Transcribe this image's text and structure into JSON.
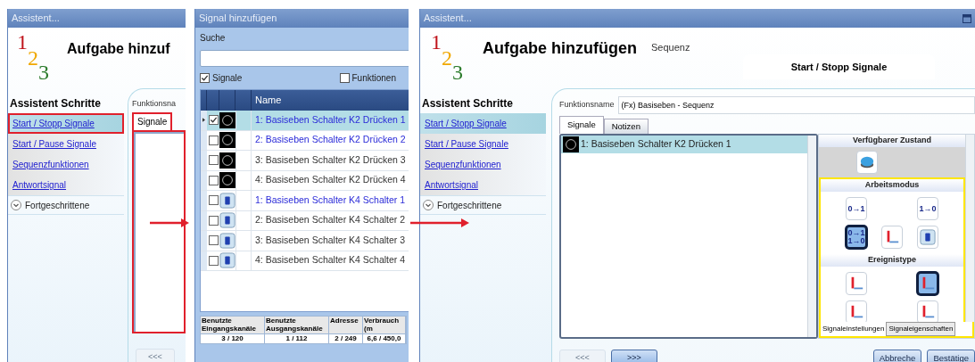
{
  "step1_window": {
    "title": "Assistent...",
    "logo_digits": [
      {
        "text": "1",
        "color": "#c0141c"
      },
      {
        "text": "2",
        "color": "#f0a800"
      },
      {
        "text": "3",
        "color": "#2a7a2a"
      }
    ],
    "heading": "Aufgabe hinzuf",
    "sidebar": {
      "title": "Assistent Schritte",
      "items": [
        {
          "label": "Start / Stopp Signale",
          "selected": true
        },
        {
          "label": "Start / Pause Signale",
          "selected": false
        },
        {
          "label": "Sequenzfunktionen",
          "selected": false
        },
        {
          "label": "Antwortsignal",
          "selected": false
        }
      ],
      "expander": {
        "label": "Fortgeschrittene",
        "expanded": false
      }
    },
    "field_label": "Funktionsna",
    "tabs": [
      {
        "label": "Signale",
        "selected": true
      }
    ],
    "back_button": "<<<"
  },
  "signal_dialog": {
    "title": "Signal hinzufügen",
    "search_label": "Suche",
    "filters": [
      {
        "label": "Signale",
        "checked": true
      },
      {
        "label": "Funktionen",
        "checked": false
      }
    ],
    "column": "Name",
    "rows": [
      {
        "name": "1: Basiseben Schalter K2 Drücken 1",
        "kind": "push",
        "checked": true,
        "selected": true,
        "color": "#2a2ad8"
      },
      {
        "name": "2: Basiseben Schalter K2 Drücken 2",
        "kind": "push",
        "checked": false,
        "selected": false,
        "color": "#2a2ad8"
      },
      {
        "name": "3: Basiseben Schalter K2 Drücken 3",
        "kind": "push",
        "checked": false,
        "selected": false,
        "color": "#333333"
      },
      {
        "name": "4: Basiseben Schalter K2 Drücken 4",
        "kind": "push",
        "checked": false,
        "selected": false,
        "color": "#333333"
      },
      {
        "name": "1: Basiseben Schalter K4 Schalter 1",
        "kind": "switch",
        "checked": false,
        "selected": false,
        "color": "#2a2ad8"
      },
      {
        "name": "2: Basiseben Schalter K4 Schalter 2",
        "kind": "switch",
        "checked": false,
        "selected": false,
        "color": "#333333"
      },
      {
        "name": "3: Basiseben Schalter K4 Schalter 3",
        "kind": "switch",
        "checked": false,
        "selected": false,
        "color": "#333333"
      },
      {
        "name": "4: Basiseben Schalter K4 Schalter 4",
        "kind": "switch",
        "checked": false,
        "selected": false,
        "color": "#333333"
      }
    ],
    "usage": {
      "columns": [
        "Benutzte Eingangskanäle",
        "Benutzte Ausgangskanäle",
        "Adresse",
        "Verbrauch (m"
      ],
      "values": [
        "3 / 120",
        "1 / 112",
        "2 / 249",
        "6,6 / 450,0"
      ]
    }
  },
  "step2_window": {
    "title": "Assistent...",
    "logo_digits": [
      {
        "text": "1",
        "color": "#c0141c"
      },
      {
        "text": "2",
        "color": "#f0a800"
      },
      {
        "text": "3",
        "color": "#2a7a2a"
      }
    ],
    "heading": "Aufgabe hinzufügen",
    "subheading": "Sequenz",
    "step_title": "Start / Stopp Signale",
    "sidebar": {
      "title": "Assistent Schritte",
      "items": [
        {
          "label": "Start / Stopp Signale",
          "selected": true
        },
        {
          "label": "Start / Pause Signale",
          "selected": false
        },
        {
          "label": "Sequenzfunktionen",
          "selected": false
        },
        {
          "label": "Antwortsignal",
          "selected": false
        }
      ],
      "expander": {
        "label": "Fortgeschrittene",
        "expanded": false
      }
    },
    "field_label": "Funktionsname",
    "field_value": "(Fx) Basiseben - Sequenz",
    "tabs": [
      {
        "label": "Signale",
        "selected": true
      },
      {
        "label": "Notizen",
        "selected": false
      }
    ],
    "signals": [
      {
        "name": "1: Basiseben Schalter K2 Drücken 1",
        "kind": "push",
        "selected": true
      }
    ],
    "properties": [
      {
        "title": "Verfügbarer Zustand",
        "items": [
          {
            "kind": "button",
            "selected": false
          }
        ]
      },
      {
        "title": "Arbeitsmodus",
        "items": [
          {
            "kind": "text",
            "label": "0→1",
            "selected": false
          },
          {
            "kind": "blank"
          },
          {
            "kind": "text",
            "label": "1→0",
            "selected": false
          },
          {
            "kind": "text",
            "label": "0→1 1→0",
            "selected": true
          },
          {
            "kind": "edge",
            "selected": false
          },
          {
            "kind": "switch",
            "selected": false
          }
        ]
      },
      {
        "title": "Ereignistype",
        "items": [
          {
            "kind": "edge",
            "selected": false
          },
          {
            "kind": "blank"
          },
          {
            "kind": "edge",
            "selected": true
          },
          {
            "kind": "edge",
            "selected": false
          },
          {
            "kind": "blank"
          },
          {
            "kind": "edge",
            "selected": false
          }
        ]
      }
    ],
    "bottom_tabs": [
      {
        "label": "Signaleinstellungen",
        "selected": true
      },
      {
        "label": "Signaleigenschaften",
        "selected": false
      }
    ],
    "buttons": [
      {
        "label": "<<<",
        "disabled": true
      },
      {
        "label": ">>>",
        "disabled": false
      }
    ],
    "dialog_buttons": [
      "Abbreche",
      "Bestätige"
    ]
  }
}
